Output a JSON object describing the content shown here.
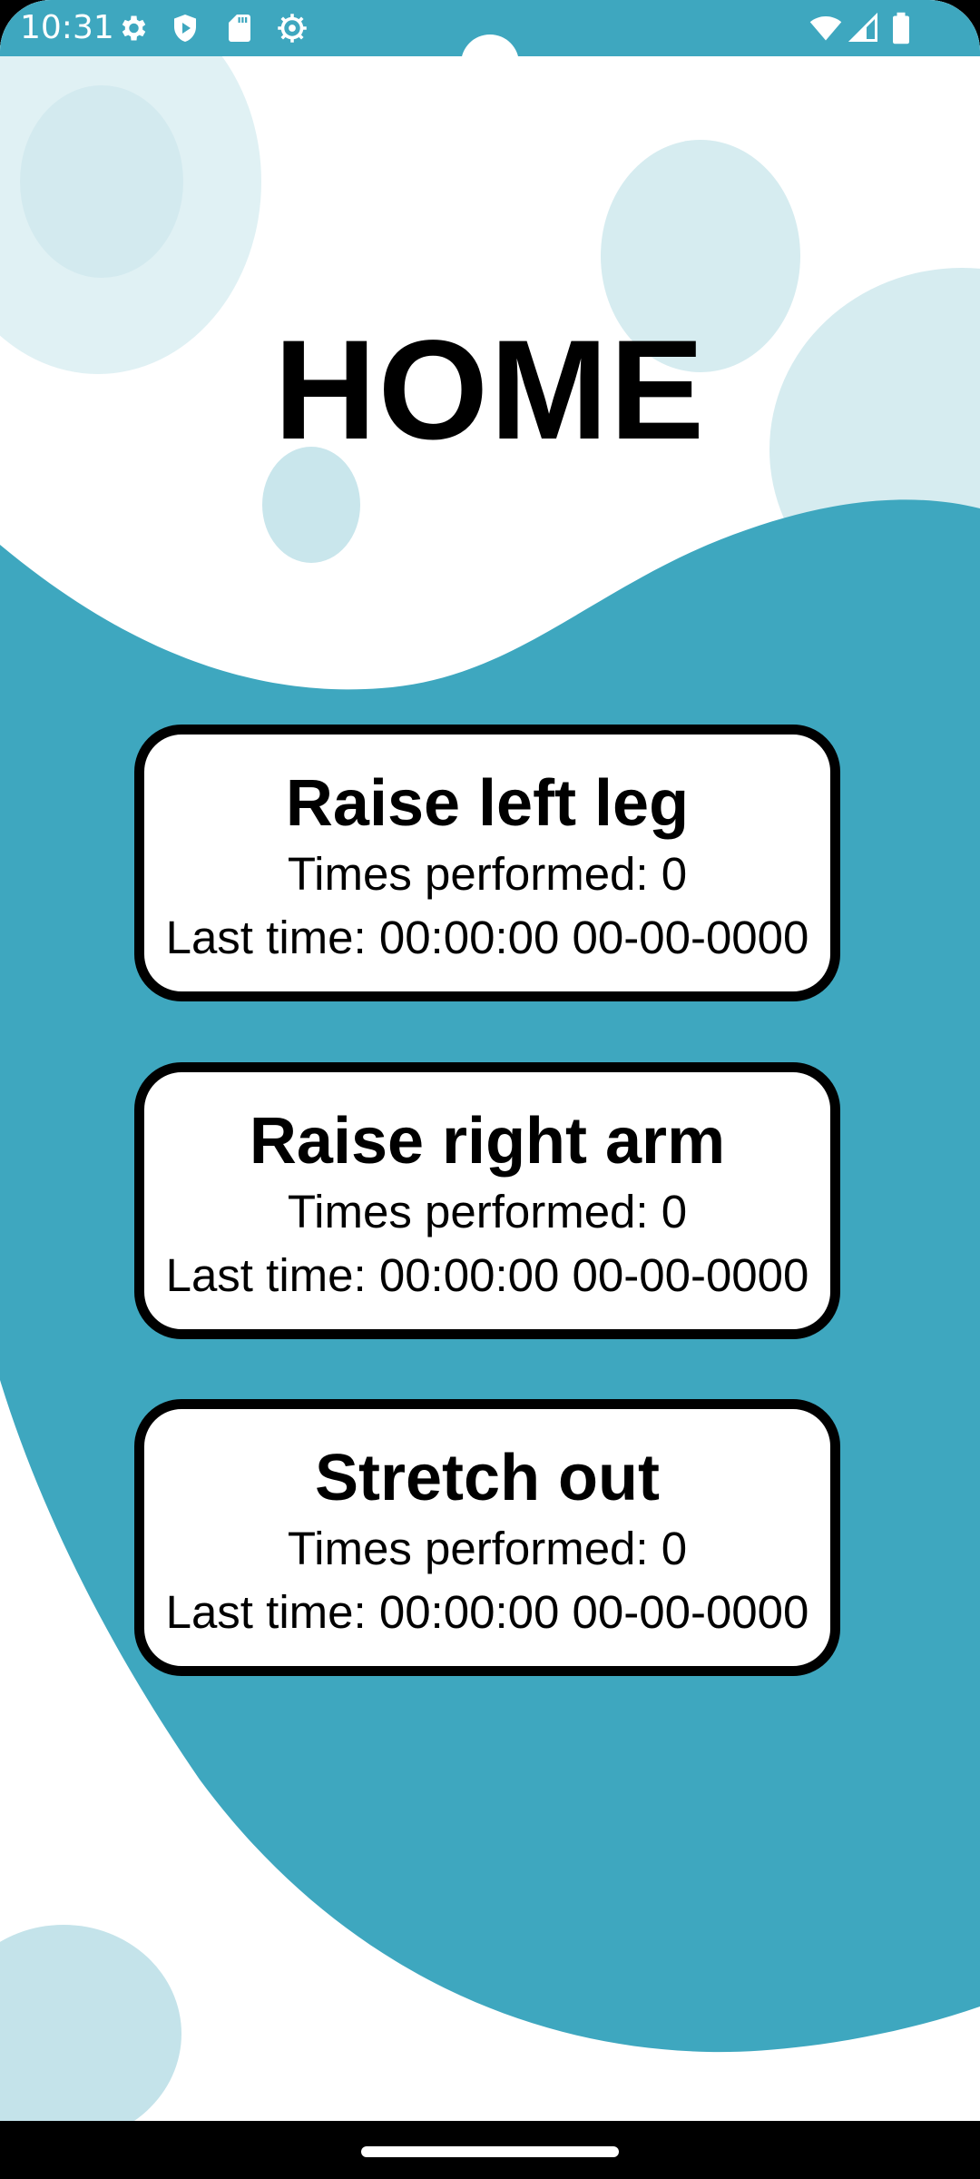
{
  "status_bar": {
    "time": "10:31",
    "background_color": "#3ea7bf",
    "left_icons": [
      "settings-gear-icon",
      "shield-play-icon",
      "sd-card-icon",
      "debug-gear-icon"
    ],
    "right_icons": [
      "wifi-icon",
      "cell-signal-icon",
      "battery-icon"
    ]
  },
  "page": {
    "title": "HOME",
    "accent_color": "#3ea7bf",
    "bubble_color": "#d8edf1"
  },
  "exercises": [
    {
      "name": "Raise left leg",
      "times_performed": "Times performed: 0",
      "last_time": "Last time: 00:00:00 00-00-0000"
    },
    {
      "name": "Raise right arm",
      "times_performed": "Times performed: 0",
      "last_time": "Last time: 00:00:00 00-00-0000"
    },
    {
      "name": "Stretch out",
      "times_performed": "Times performed: 0",
      "last_time": "Last time: 00:00:00 00-00-0000"
    }
  ],
  "navigation": {
    "handle": "home-gesture-handle"
  }
}
